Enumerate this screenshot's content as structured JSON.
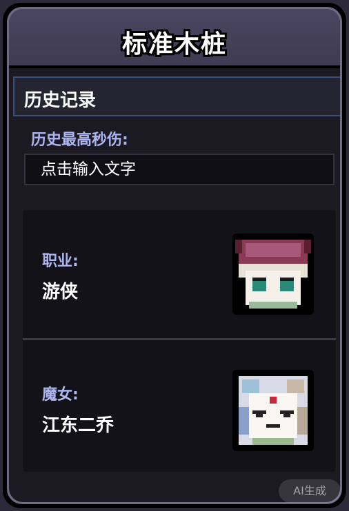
{
  "title": "标准木桩",
  "section": {
    "label": "历史记录"
  },
  "best_dps": {
    "label": "历史最高秒伤:",
    "placeholder": "点击输入文字"
  },
  "characters": [
    {
      "key": "职业:",
      "value": "游侠",
      "portrait_icon": "ranger-portrait-icon"
    },
    {
      "key": "魔女:",
      "value": "江东二乔",
      "portrait_icon": "witch-portrait-icon"
    }
  ],
  "watermark": "AI生成"
}
